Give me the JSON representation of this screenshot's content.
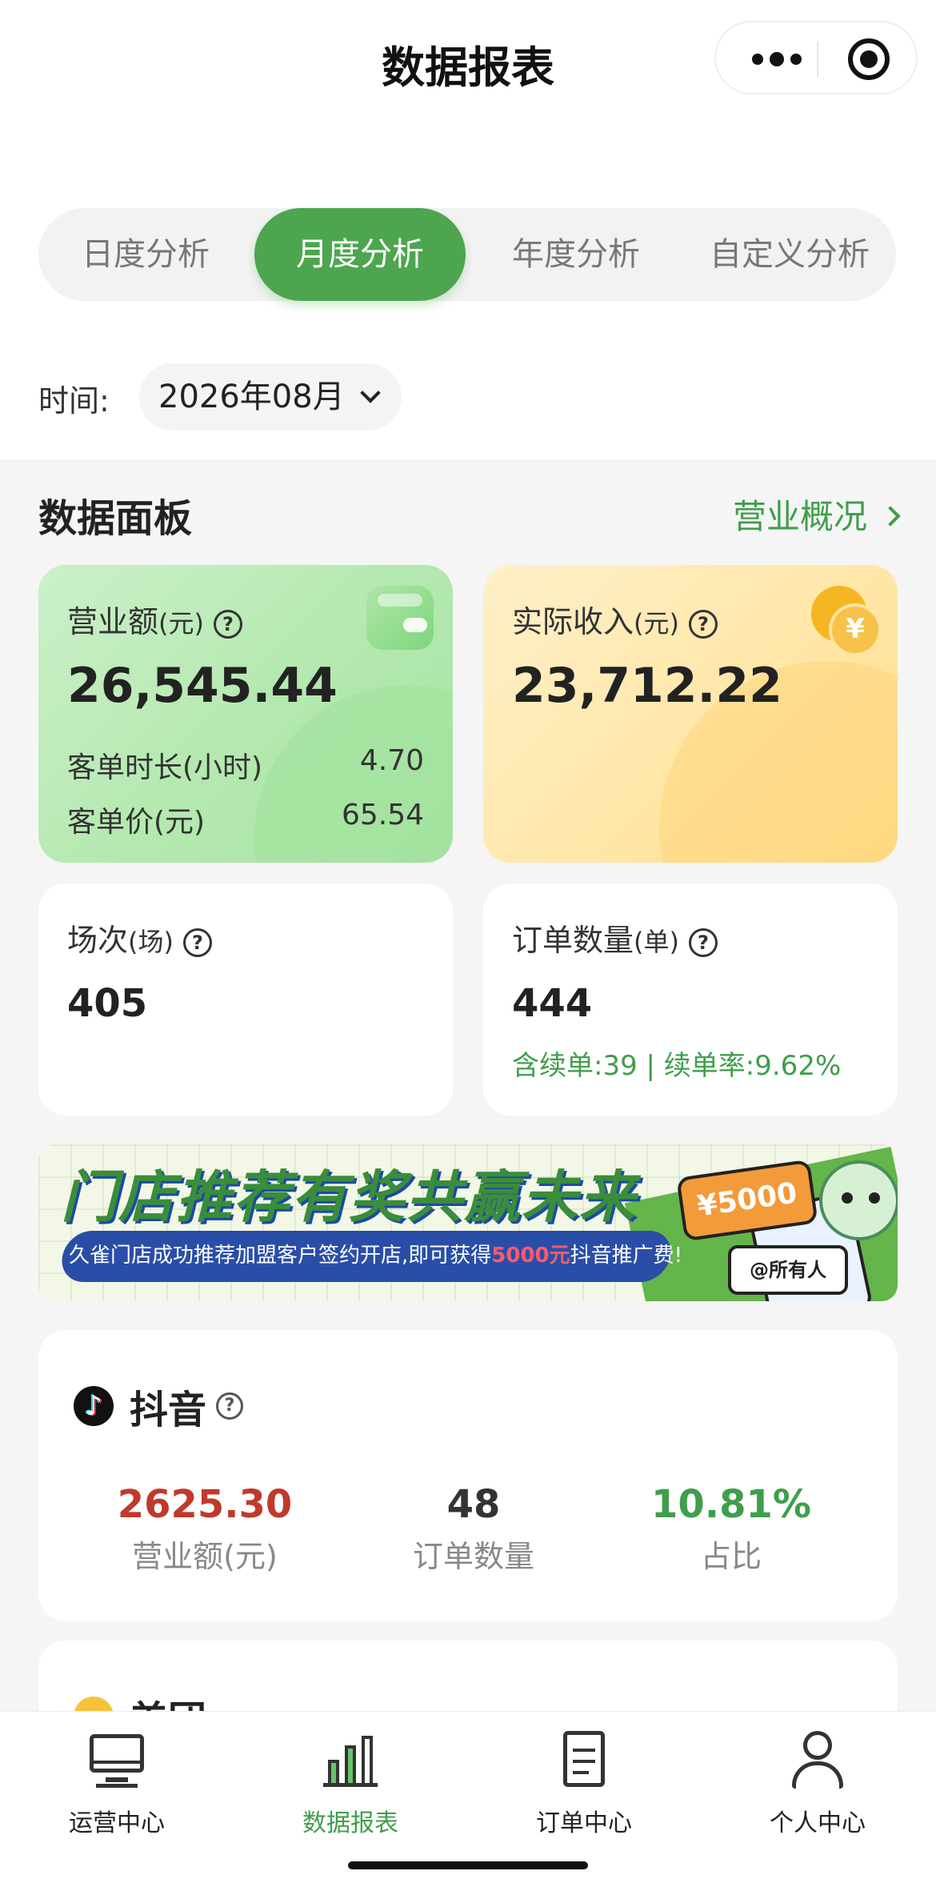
{
  "nav": {
    "title": "数据报表",
    "capsule_more_icon": "more-dots-icon",
    "capsule_close_icon": "target-icon"
  },
  "tabs": [
    {
      "label": "日度分析",
      "active": false
    },
    {
      "label": "月度分析",
      "active": true
    },
    {
      "label": "年度分析",
      "active": false
    },
    {
      "label": "自定义分析",
      "active": false
    }
  ],
  "time": {
    "label": "时间:",
    "value": "2026年08月"
  },
  "dashboard": {
    "title": "数据面板",
    "link": "营业概况",
    "revenue": {
      "label": "营业额",
      "unit": "(元)",
      "value": "26,545.44",
      "rows": [
        {
          "k": "客单时长(小时)",
          "v": "4.70"
        },
        {
          "k": "客单价(元)",
          "v": "65.54"
        }
      ]
    },
    "income": {
      "label": "实际收入",
      "unit": "(元)",
      "value": "23,712.22",
      "coin_symbol": "¥"
    },
    "sessions": {
      "label": "场次",
      "unit": "(场)",
      "value": "405"
    },
    "orders": {
      "label": "订单数量",
      "unit": "(单)",
      "value": "444",
      "note": "含续单:39 | 续单率:9.62%"
    },
    "help_symbol": "?"
  },
  "banner": {
    "headline": "门店推荐有奖共赢未来",
    "sub_prefix": "久雀门店成功推荐加盟客户签约开店,即可获得",
    "sub_highlight": "5000元",
    "sub_suffix": "抖音推广费!",
    "price": "¥5000",
    "tag": "@所有人"
  },
  "platforms": [
    {
      "name": "抖音",
      "icon": "tiktok-icon",
      "revenue": "2625.30",
      "revenue_label": "营业额(元)",
      "orders": "48",
      "orders_label": "订单数量",
      "share": "10.81%",
      "share_label": "占比"
    },
    {
      "name": "美团",
      "icon": "meituan-icon"
    }
  ],
  "bottom_nav": [
    {
      "label": "运营中心",
      "icon": "monitor-icon",
      "active": false
    },
    {
      "label": "数据报表",
      "icon": "bar-chart-icon",
      "active": true
    },
    {
      "label": "订单中心",
      "icon": "document-icon",
      "active": false
    },
    {
      "label": "个人中心",
      "icon": "user-icon",
      "active": false
    }
  ],
  "colors": {
    "accent": "#4ea54f",
    "accent_text": "#3f9e4b",
    "revenue_red": "#c0392b",
    "share_green": "#3f9e4b"
  }
}
